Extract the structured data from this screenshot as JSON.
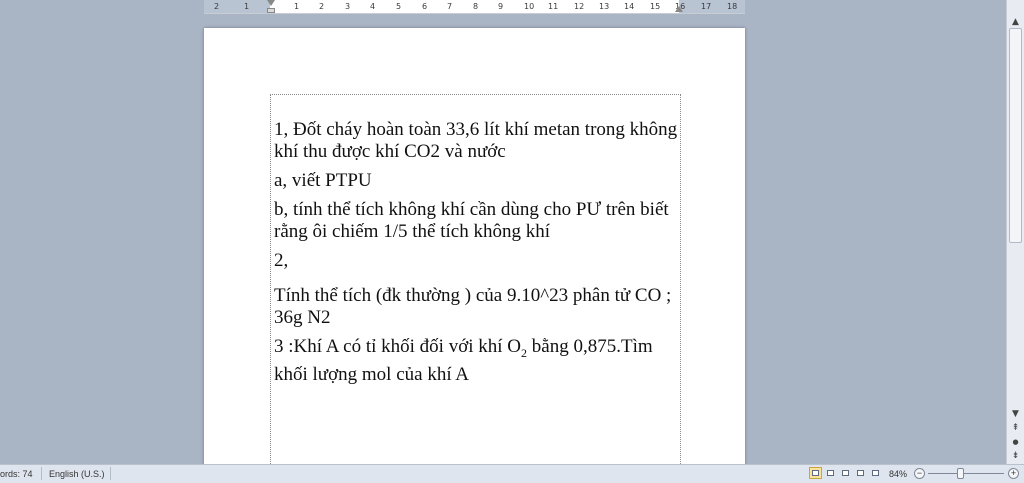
{
  "ruler": {
    "ticks": [
      "2",
      "1",
      "1",
      "2",
      "3",
      "4",
      "5",
      "6",
      "7",
      "8",
      "9",
      "10",
      "11",
      "12",
      "13",
      "14",
      "15",
      "16",
      "17",
      "18"
    ]
  },
  "document": {
    "p1": "1, Đốt cháy hoàn toàn 33,6 lít khí metan trong không khí thu được khí CO2 và nước",
    "p2": "a, viết PTPU",
    "p3": "b, tính thể tích không khí cần dùng cho PƯ trên biết rằng ôi chiếm 1/5 thể tích không khí",
    "p4": "2,",
    "p5": " Tính thể tích (đk thường ) của 9.10^23  phân tử CO ; 36g N2",
    "p6_a": "3 :Khí A có tỉ khối đối với khí O",
    "p6_sub": "2",
    "p6_b": " bằng 0,875.Tìm khối lượng mol của khí A"
  },
  "statusbar": {
    "words": "ords: 74",
    "language": "English (U.S.)",
    "zoom": "84%",
    "zoom_minus": "−",
    "zoom_plus": "+"
  },
  "icons": {
    "scroll_up": "▲",
    "scroll_down": "▼",
    "prev_page": "⇞",
    "next_page": "⇟",
    "browse_object": "●"
  }
}
